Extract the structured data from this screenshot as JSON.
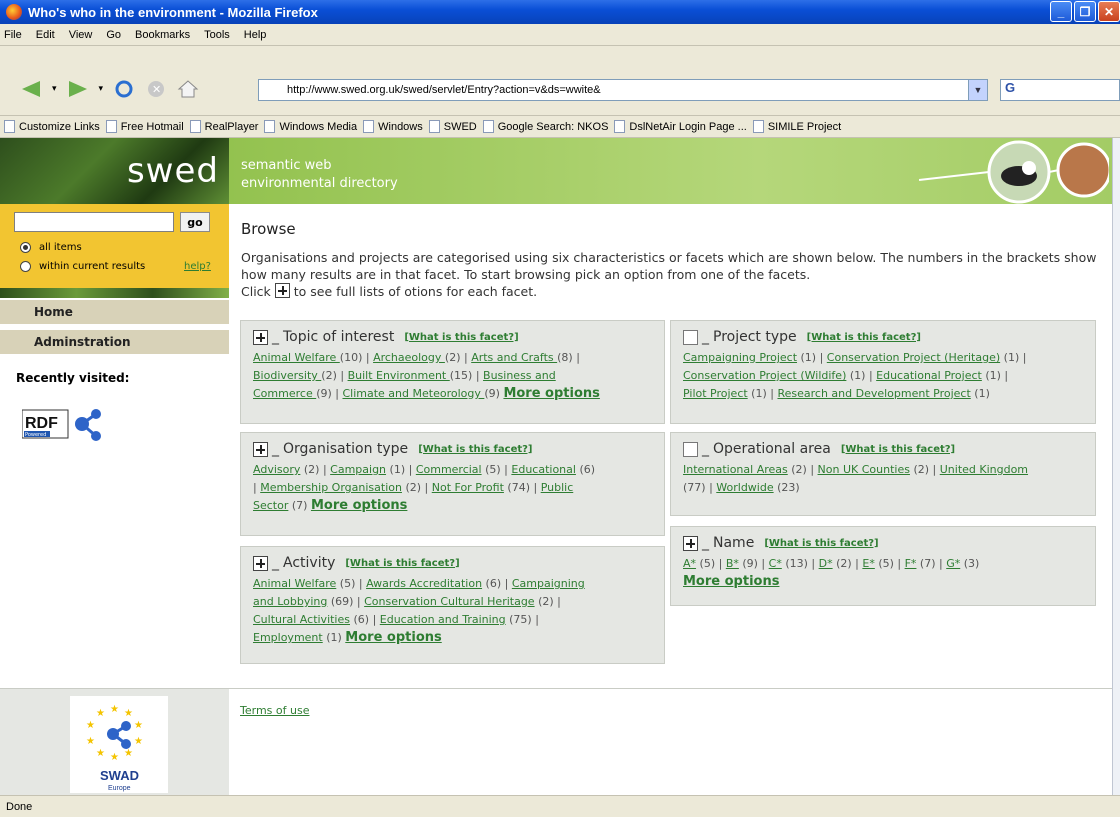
{
  "window": {
    "title": "Who's who in the environment - Mozilla Firefox"
  },
  "menu": [
    "File",
    "Edit",
    "View",
    "Go",
    "Bookmarks",
    "Tools",
    "Help"
  ],
  "address": {
    "url": "http://www.swed.org.uk/swed/servlet/Entry?action=v&ds=wwite&"
  },
  "google_box": {
    "label": "G"
  },
  "bookmarks": [
    "Customize Links",
    "Free Hotmail",
    "RealPlayer",
    "Windows Media",
    "Windows",
    "SWED",
    "Google Search: NKOS",
    "DslNetAir Login Page ...",
    "SIMILE Project"
  ],
  "site": {
    "logo": "swed",
    "tagline1": "semantic web",
    "tagline2": "environmental directory"
  },
  "search": {
    "go": "go",
    "all_items": "all items",
    "within": "within current results",
    "help": "help?"
  },
  "nav": {
    "home": "Home",
    "admin": "Adminstration"
  },
  "recent": {
    "label": "Recently visited:"
  },
  "rdf": {
    "label": "RDF",
    "sub": "Powered"
  },
  "browse": {
    "title": "Browse",
    "intro": "Organisations and projects are categorised using six characteristics or facets which are shown below. The numbers in the brackets show how many results are in that facet. To start browsing pick an option from one of the facets.",
    "click_pre": "Click",
    "click_post": "to see full lists of otions for each facet."
  },
  "facets": {
    "what": "[What is this facet?]",
    "more": "More options",
    "topic": {
      "title": "Topic of interest"
    },
    "orgtype": {
      "title": "Organisation type"
    },
    "activity": {
      "title": "Activity"
    },
    "project": {
      "title": "Project type"
    },
    "area": {
      "title": "Operational area"
    },
    "name": {
      "title": "Name"
    }
  },
  "footer": {
    "terms": "Terms of use",
    "swad": "SWAD",
    "swad_sub": "Europe"
  },
  "status": {
    "text": "Done"
  }
}
